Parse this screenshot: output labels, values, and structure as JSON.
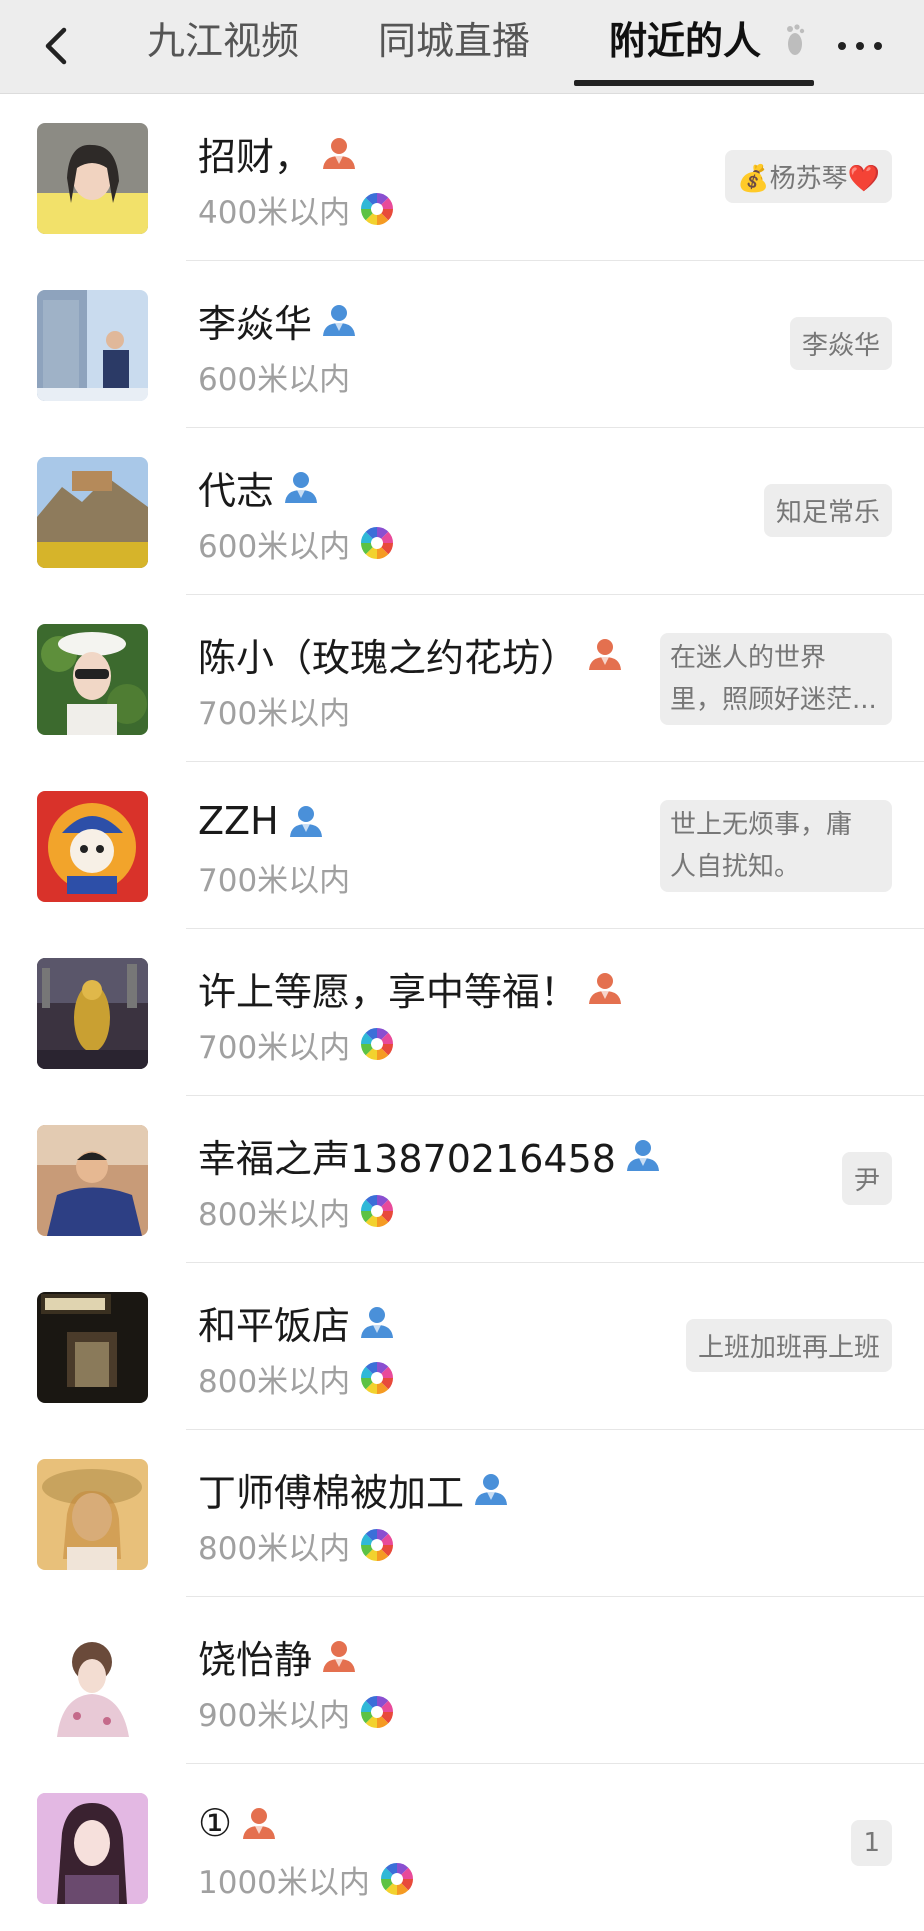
{
  "header": {
    "tabs": [
      "九江视频",
      "同城直播",
      "附近的人"
    ],
    "active_tab": "附近的人"
  },
  "people": [
    {
      "name": "招财，",
      "gender": "female",
      "distance": "400米以内",
      "moments": true,
      "signature": [
        "💰杨苏琴❤️"
      ]
    },
    {
      "name": "李焱华",
      "gender": "male",
      "distance": "600米以内",
      "moments": false,
      "signature": [
        "李焱华"
      ]
    },
    {
      "name": "代志",
      "gender": "male",
      "distance": "600米以内",
      "moments": true,
      "signature": [
        "知足常乐"
      ]
    },
    {
      "name": "陈小（玫瑰之约花坊）",
      "gender": "female",
      "distance": "700米以内",
      "moments": false,
      "signature": [
        "在迷人的世界",
        "里，照顾好迷茫..."
      ]
    },
    {
      "name": "ZZH",
      "gender": "male",
      "distance": "700米以内",
      "moments": false,
      "signature": [
        "世上无烦事，庸",
        "人自扰知。"
      ]
    },
    {
      "name": "许上等愿，享中等福！",
      "gender": "female",
      "distance": "700米以内",
      "moments": true,
      "signature": []
    },
    {
      "name": "幸福之声13870216458",
      "gender": "male",
      "distance": "800米以内",
      "moments": true,
      "signature": [
        "尹"
      ]
    },
    {
      "name": "和平饭店",
      "gender": "male",
      "distance": "800米以内",
      "moments": true,
      "signature": [
        "上班加班再上班"
      ]
    },
    {
      "name": "丁师傅棉被加工",
      "gender": "male",
      "distance": "800米以内",
      "moments": true,
      "signature": []
    },
    {
      "name": "饶怡静",
      "gender": "female",
      "distance": "900米以内",
      "moments": true,
      "signature": []
    },
    {
      "name": "①",
      "gender": "female",
      "distance": "1000米以内",
      "moments": true,
      "signature": [
        "1"
      ]
    }
  ],
  "colors": {
    "female": "#e4704f",
    "male": "#4a90d9",
    "distance_text": "#a0a0a0",
    "signature_bg": "#ededed"
  }
}
